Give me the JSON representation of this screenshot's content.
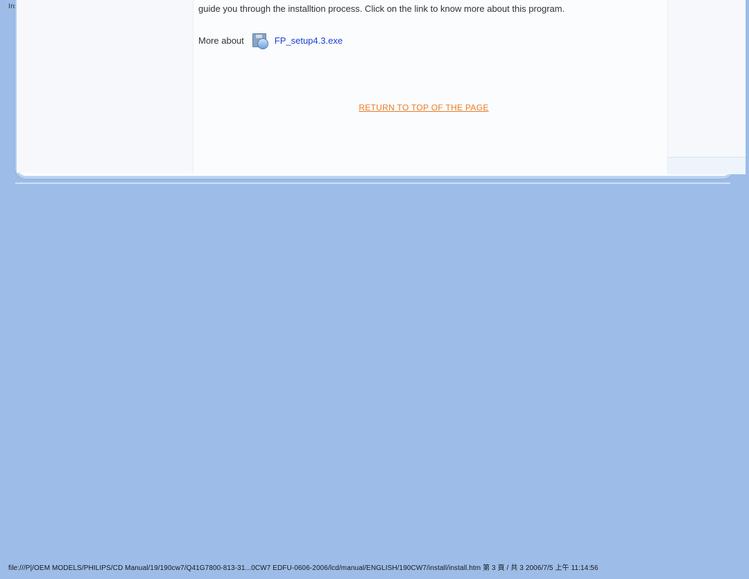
{
  "window": {
    "title": "Installing Your LCD Monitor"
  },
  "main": {
    "paragraph": "guide you through the installtion process. Click on the link to know more about this program.",
    "more_label": "More about",
    "download_link": "FP_setup4.3.exe",
    "return_link": "RETURN TO TOP OF THE PAGE"
  },
  "footer": {
    "path": "file:///P|/OEM MODELS/PHILIPS/CD Manual/19/190cw7/Q41G7800-813-31...0CW7 EDFU-0606-2006/lcd/manual/ENGLISH/190CW7/install/install.htm 第 3 頁 / 共 3 2006/7/5 上午 11:14:56"
  }
}
